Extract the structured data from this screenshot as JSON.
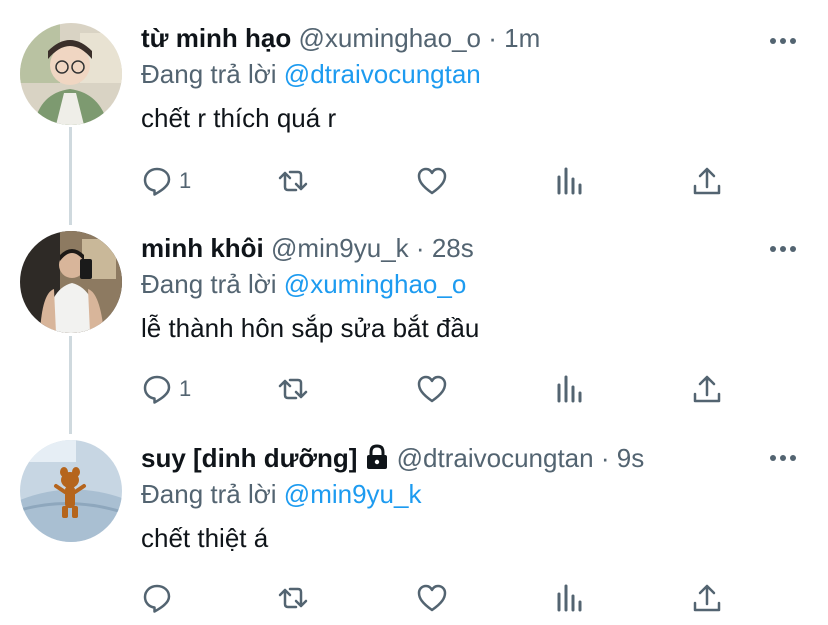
{
  "tweets": [
    {
      "name": "từ minh hạo",
      "handle": "@xuminghao_o",
      "time": "1m",
      "reply_prefix": "Đang trả lời",
      "reply_to": "@dtraivocungtan",
      "text": "chết r thích quá r",
      "reply_count": "1",
      "locked": false
    },
    {
      "name": "minh khôi",
      "handle": "@min9yu_k",
      "time": "28s",
      "reply_prefix": "Đang trả lời",
      "reply_to": "@xuminghao_o",
      "text": "lễ thành hôn sắp sửa bắt đầu",
      "reply_count": "1",
      "locked": false
    },
    {
      "name": "suy [dinh dưỡng]",
      "handle": "@dtraivocungtan",
      "time": "9s",
      "reply_prefix": "Đang trả lời",
      "reply_to": "@min9yu_k",
      "text": "chết thiệt á",
      "reply_count": "",
      "locked": true
    }
  ],
  "separator": "·",
  "icons": [
    "more-icon",
    "reply-icon",
    "retweet-icon",
    "like-icon",
    "analytics-icon",
    "share-icon",
    "lock-icon"
  ],
  "colors": {
    "accent": "#1d9bf0",
    "secondary_text": "#536471",
    "thread_line": "#cfd9de"
  }
}
